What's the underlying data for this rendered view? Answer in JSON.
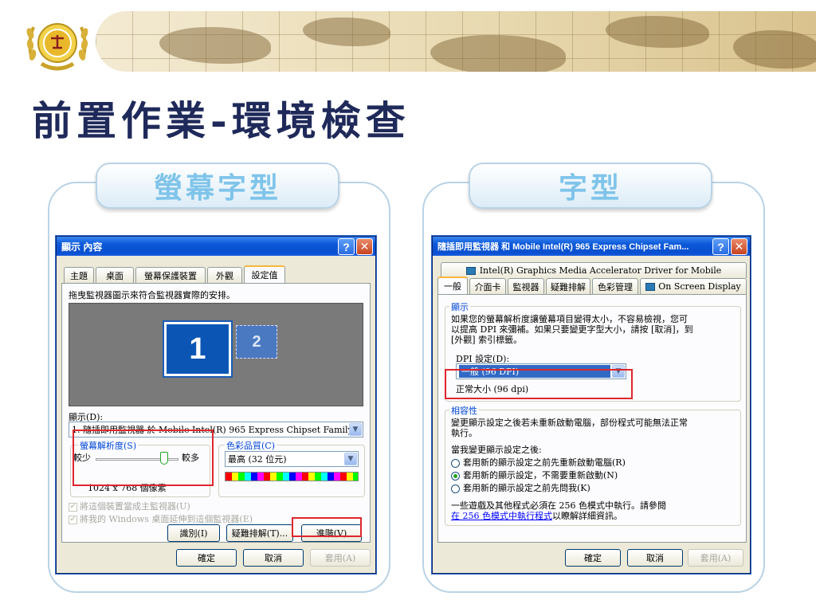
{
  "page": {
    "title": "前置作業-環境檢查"
  },
  "left_section": {
    "header": "螢幕字型",
    "dialog": {
      "title": "顯示 內容",
      "tabs": [
        "主題",
        "桌面",
        "螢幕保護裝置",
        "外觀",
        "設定值"
      ],
      "active_tab": "設定值",
      "instruction": "拖曳監視器圖示來符合監視器實際的安排。",
      "monitor_primary": "1",
      "monitor_secondary": "2",
      "display_label": "顯示(D):",
      "display_value": "1. 隨插即用監視器 於 Mobile Intel(R) 965 Express Chipset Family",
      "resolution_group": "螢幕解析度(S)",
      "slider_less": "較少",
      "slider_more": "較多",
      "resolution_value": "1024 x 768 個像素",
      "color_group": "色彩品質(C)",
      "color_value": "最高 (32 位元)",
      "checkbox_primary": "將這個裝置當成主監視器(U)",
      "checkbox_extend": "將我的 Windows 桌面延伸到這個監視器(E)",
      "btn_identify": "識別(I)",
      "btn_troubleshoot": "疑難排解(T)...",
      "btn_advanced": "進階(V)",
      "btn_ok": "確定",
      "btn_cancel": "取消",
      "btn_apply": "套用(A)"
    }
  },
  "right_section": {
    "header": "字型",
    "dialog": {
      "title": "隨插即用監視器 和 Mobile Intel(R) 965 Express Chipset Fam...",
      "tabs_row1": [
        "Intel(R) Graphics Media Accelerator Driver for Mobile"
      ],
      "tabs_row2": [
        "一般",
        "介面卡",
        "監視器",
        "疑難排解",
        "色彩管理",
        "On Screen Display"
      ],
      "active_tab": "一般",
      "display_group": "顯示",
      "display_text_1": "如果您的螢幕解析度讓螢幕項目變得太小，不容易檢視，您可",
      "display_text_2": "以提高 DPI 來彌補。如果只要變更字型大小，請按 [取消]，到",
      "display_text_3": "[外觀] 索引標籤。",
      "dpi_label": "DPI 設定(D):",
      "dpi_value": "一般 (96 DPI)",
      "dpi_normal": "正常大小 (96 dpi)",
      "compat_group": "相容性",
      "compat_text_1": "變更顯示設定之後若未重新啟動電腦，部份程式可能無法正常",
      "compat_text_2": "執行。",
      "after_change": "當我變更顯示設定之後:",
      "radio_1": "套用新的顯示設定之前先重新啟動電腦(R)",
      "radio_2": "套用新的顯示設定，不需要重新啟動(N)",
      "radio_3": "套用新的顯示設定之前先問我(K)",
      "radio_selected": 2,
      "games_text": "一些遊戲及其他程式必須在 256 色模式中執行。請參閱",
      "games_link": "在 256 色模式中執行程式",
      "games_suffix": "以瞭解詳細資訊。",
      "btn_ok": "確定",
      "btn_cancel": "取消",
      "btn_apply": "套用(A)"
    }
  },
  "colors": {
    "title": "#1f2a5a",
    "header_text": "#7fc4ea",
    "frame": "#b9d3e6",
    "xp_blue": "#0a4fd0",
    "highlight_red": "#e0262c"
  }
}
